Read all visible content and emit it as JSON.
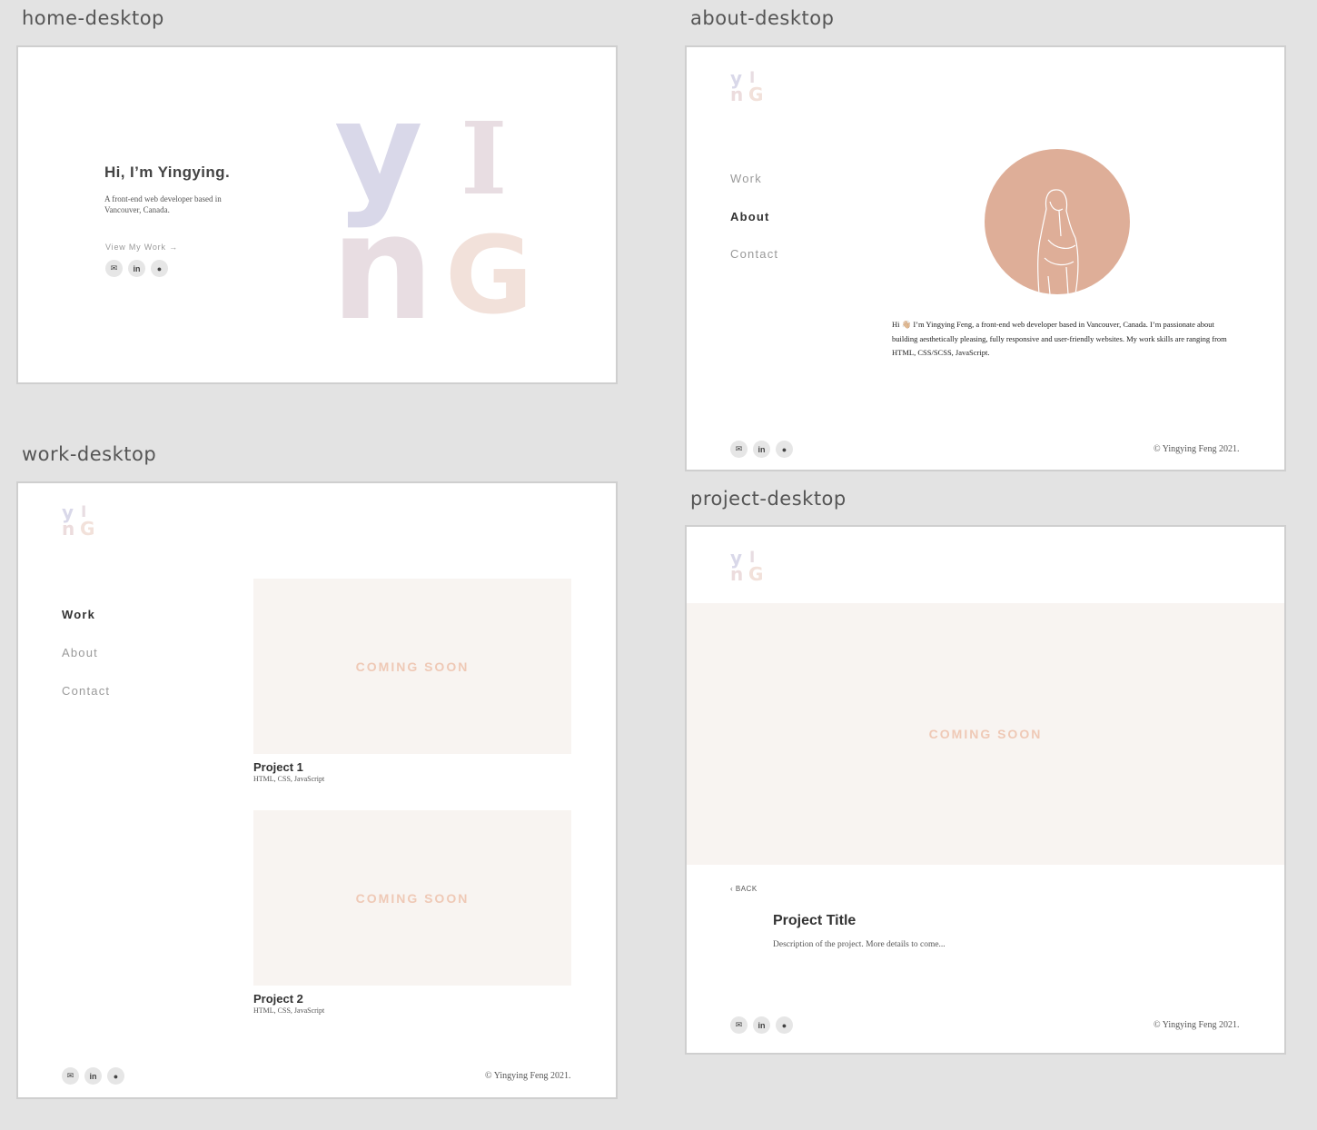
{
  "frames": {
    "home": "home-desktop",
    "about": "about-desktop",
    "work": "work-desktop",
    "project": "project-desktop"
  },
  "logo_letters": {
    "y": "y",
    "i": "I",
    "n": "n",
    "g": "G"
  },
  "home": {
    "heading": "Hi, I’m Yingying.",
    "subtitle_line1": "A front-end web developer based in",
    "subtitle_line2": "Vancouver, Canada.",
    "cta": "View My Work →"
  },
  "nav": {
    "work": "Work",
    "about": "About",
    "contact": "Contact"
  },
  "social_icons": [
    "mail-icon",
    "linkedin-icon",
    "github-icon"
  ],
  "social_labels": {
    "linkedin": "in"
  },
  "about": {
    "bio_line1": "Hi 👋🏼 I’m Yingying Feng, a front-end web developer based in Vancouver, Canada. I’m passionate about",
    "bio_line2": "building aesthetically pleasing, fully responsive and user-friendly websites.  My work skills are ranging from",
    "bio_line3": "HTML, CSS/SCSS, JavaScript."
  },
  "copyright": "© Yingying Feng 2021.",
  "work": {
    "projects": [
      {
        "placeholder": "COMING SOON",
        "title": "Project 1",
        "tags": "HTML, CSS, JavaScript"
      },
      {
        "placeholder": "COMING SOON",
        "title": "Project 2",
        "tags": "HTML, CSS, JavaScript"
      }
    ]
  },
  "project": {
    "placeholder": "COMING SOON",
    "back": "‹ BACK",
    "title": "Project Title",
    "description": "Description of the project. More details to come..."
  },
  "colors": {
    "accent_lavender": "#d9d8e9",
    "accent_mauve": "#e8dde2",
    "accent_peach": "#f2e1da",
    "avatar_bg": "#deae98",
    "placeholder_bg": "#f8f4f1",
    "placeholder_text": "#efc9b6"
  }
}
